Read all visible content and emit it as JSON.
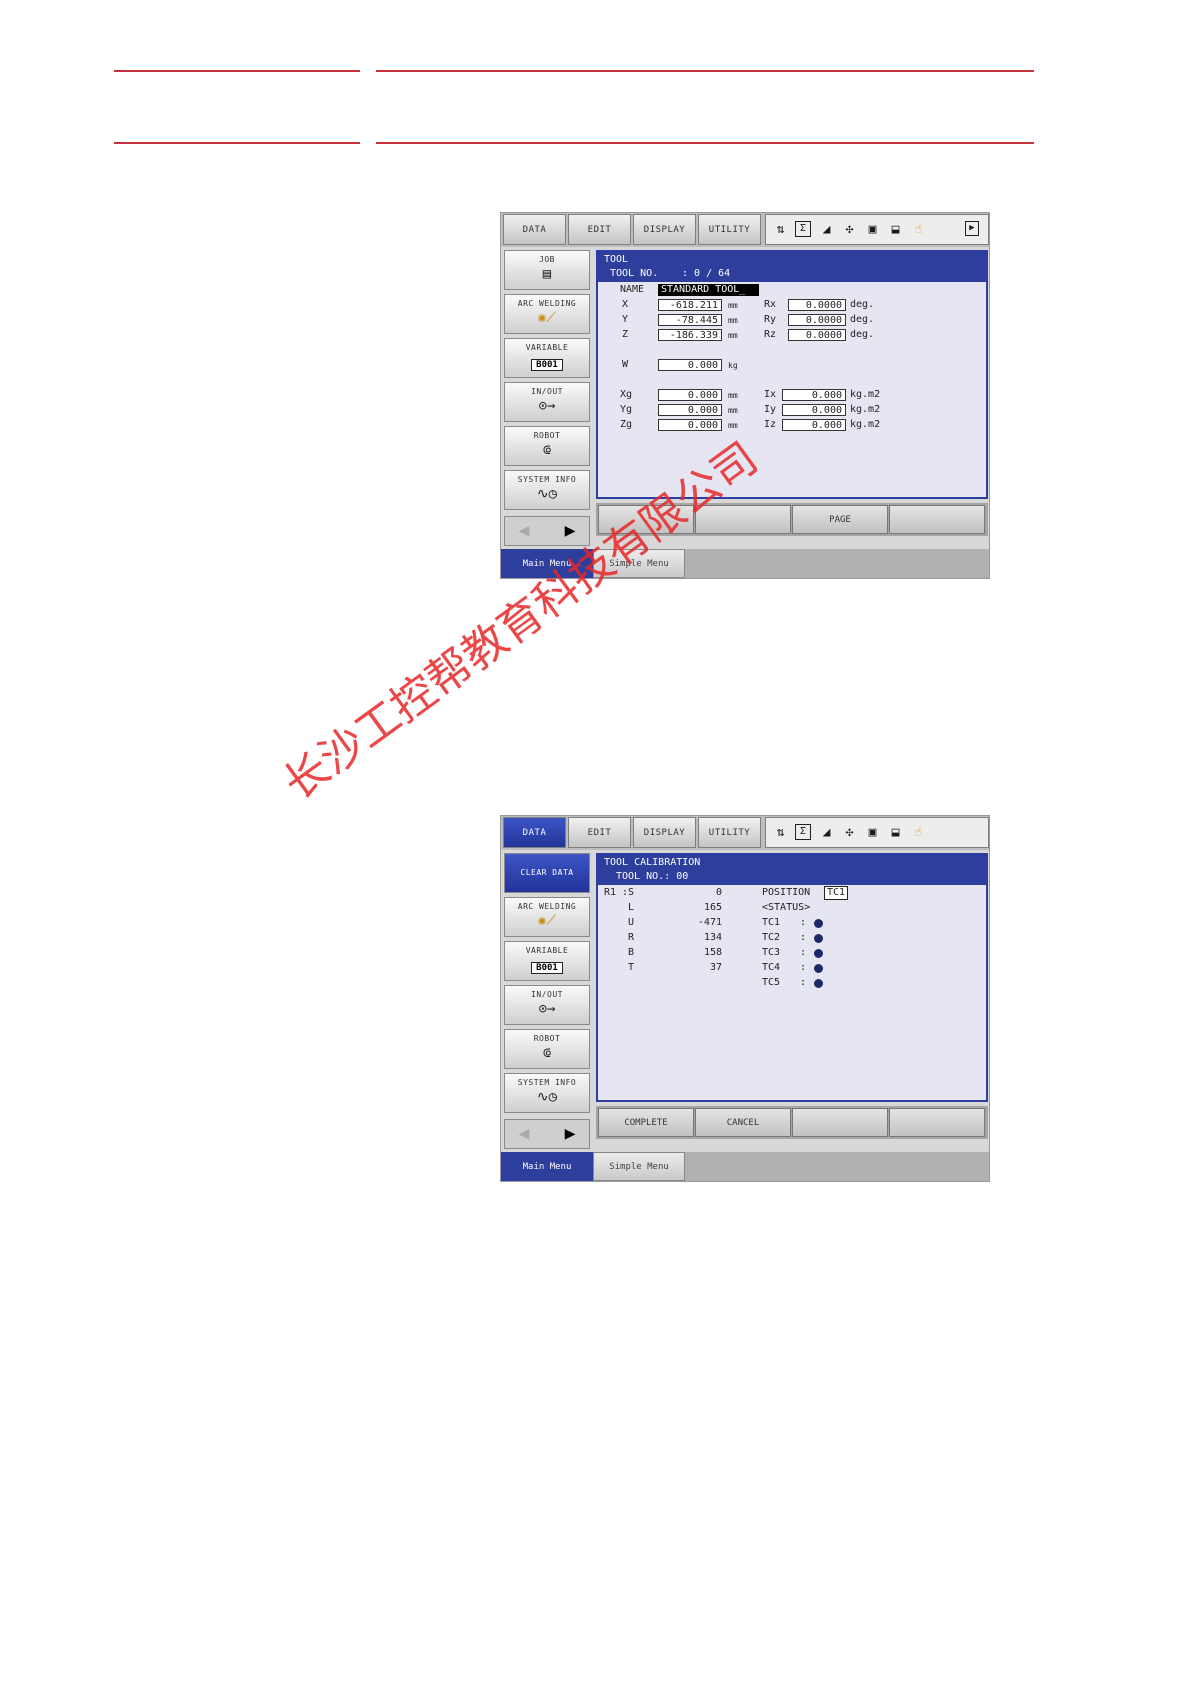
{
  "screen1": {
    "menu": [
      "DATA",
      "EDIT",
      "DISPLAY",
      "UTILITY"
    ],
    "sidebar": [
      {
        "label": "JOB",
        "icon": "job-icon"
      },
      {
        "label": "ARC WELDING",
        "icon": "welding-torch-icon"
      },
      {
        "label": "VARIABLE",
        "icon": "variable-icon",
        "box": "B001"
      },
      {
        "label": "IN/OUT",
        "icon": "inout-icon"
      },
      {
        "label": "ROBOT",
        "icon": "robot-arm-icon"
      },
      {
        "label": "SYSTEM INFO",
        "icon": "system-info-icon"
      }
    ],
    "header": {
      "title": "TOOL",
      "tool_no_label": "TOOL NO.",
      "tool_no_value": ": 0 / 64"
    },
    "name_label": "NAME",
    "name_value": "STANDARD TOOL_",
    "pos": [
      {
        "label": "X",
        "value": "-618.211",
        "unit": "mm"
      },
      {
        "label": "Y",
        "value": "-78.445",
        "unit": "mm"
      },
      {
        "label": "Z",
        "value": "-186.339",
        "unit": "mm"
      }
    ],
    "rot": [
      {
        "label": "Rx",
        "value": "0.0000",
        "unit": "deg."
      },
      {
        "label": "Ry",
        "value": "0.0000",
        "unit": "deg."
      },
      {
        "label": "Rz",
        "value": "0.0000",
        "unit": "deg."
      }
    ],
    "weight": {
      "label": "W",
      "value": "0.000",
      "unit": "kg"
    },
    "cog": [
      {
        "label": "Xg",
        "value": "0.000",
        "unit": "mm"
      },
      {
        "label": "Yg",
        "value": "0.000",
        "unit": "mm"
      },
      {
        "label": "Zg",
        "value": "0.000",
        "unit": "mm"
      }
    ],
    "inertia": [
      {
        "label": "Ix",
        "value": "0.000",
        "unit": "kg.m2"
      },
      {
        "label": "Iy",
        "value": "0.000",
        "unit": "kg.m2"
      },
      {
        "label": "Iz",
        "value": "0.000",
        "unit": "kg.m2"
      }
    ],
    "bottom": [
      "",
      "",
      "PAGE",
      ""
    ],
    "tabs": [
      "Main Menu",
      "Simple Menu"
    ]
  },
  "screen2": {
    "menu": [
      "DATA",
      "EDIT",
      "DISPLAY",
      "UTILITY"
    ],
    "dropdown_item": "CLEAR DATA",
    "sidebar": [
      {
        "label": "ARC WELDING",
        "icon": "welding-torch-icon"
      },
      {
        "label": "VARIABLE",
        "icon": "variable-icon",
        "box": "B001"
      },
      {
        "label": "IN/OUT",
        "icon": "inout-icon"
      },
      {
        "label": "ROBOT",
        "icon": "robot-arm-icon"
      },
      {
        "label": "SYSTEM INFO",
        "icon": "system-info-icon"
      }
    ],
    "header": {
      "title": "TOOL CALIBRATION",
      "tool_no": "TOOL NO.: 00"
    },
    "robot_label": "R1 :",
    "axes": [
      {
        "axis": "S",
        "value": "0"
      },
      {
        "axis": "L",
        "value": "165"
      },
      {
        "axis": "U",
        "value": "-471"
      },
      {
        "axis": "R",
        "value": "134"
      },
      {
        "axis": "B",
        "value": "158"
      },
      {
        "axis": "T",
        "value": "37"
      }
    ],
    "position_label": "POSITION",
    "position_value": "TC1",
    "status_label": "<STATUS>",
    "status": [
      {
        "name": "TC1",
        "sep": ":"
      },
      {
        "name": "TC2",
        "sep": ":"
      },
      {
        "name": "TC3",
        "sep": ":"
      },
      {
        "name": "TC4",
        "sep": ":"
      },
      {
        "name": "TC5",
        "sep": ":"
      }
    ],
    "bottom": [
      "COMPLETE",
      "CANCEL",
      "",
      ""
    ],
    "tabs": [
      "Main Menu",
      "Simple Menu"
    ]
  },
  "watermark": "长沙工控帮教育科技有限公司",
  "colors": {
    "rule": "#c8323c",
    "accent": "#2e3e9c",
    "watermark": "#e62828"
  }
}
